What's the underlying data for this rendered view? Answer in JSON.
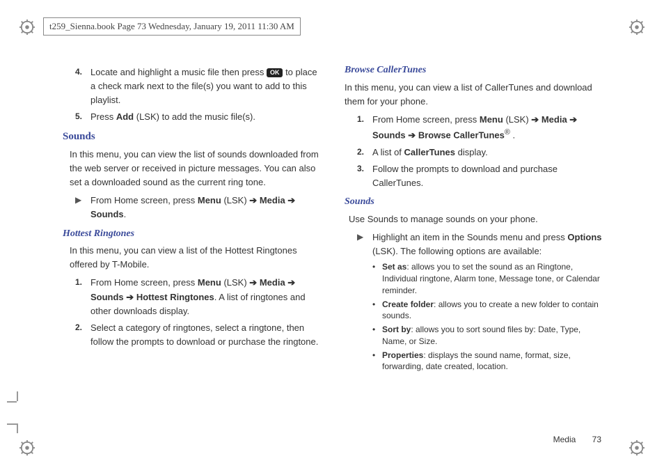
{
  "header": "t259_Sienna.book  Page 73  Wednesday, January 19, 2011  11:30 AM",
  "ok_label": "OK",
  "arrow": "➔",
  "tri": "▶",
  "left": {
    "step4_a": "Locate and highlight a music file then press ",
    "step4_b": " to place a check mark next to the file(s) you want to add to this playlist.",
    "step5_a": "Press ",
    "step5_b": "Add",
    "step5_c": " (LSK) to add the music file(s).",
    "sounds_h": "Sounds",
    "sounds_p": "In this menu, you can view the list of sounds downloaded from the web server or received in picture messages. You can also set a downloaded sound as the current ring tone.",
    "sounds_nav_a": "From Home screen, press ",
    "sounds_nav_b": "Menu",
    "sounds_nav_c": " (LSK) ",
    "sounds_nav_d": "Media",
    "sounds_nav_e": "Sounds",
    "hottest_h": "Hottest Ringtones",
    "hottest_p": "In this menu, you can view a list of the Hottest Ringtones offered by T-Mobile.",
    "hot1_a": "From Home screen, press ",
    "hot1_b": "Menu",
    "hot1_c": " (LSK) ",
    "hot1_d": "Media",
    "hot1_e": "Sounds",
    "hot1_f": "Hottest Ringtones",
    "hot1_g": ". A list of ringtones and other downloads display.",
    "hot2": "Select a category of ringtones, select a ringtone, then follow the prompts to download or purchase the ringtone."
  },
  "right": {
    "browse_h": "Browse CallerTunes",
    "browse_p": "In this menu, you can view a list of CallerTunes and download them for your phone.",
    "b1_a": "From Home screen, press ",
    "b1_b": "Menu",
    "b1_c": " (LSK) ",
    "b1_d": "Media",
    "b1_e": "Sounds",
    "b1_f": "Browse CallerTunes",
    "b1_g": " .",
    "b2_a": "A list of ",
    "b2_b": "CallerTunes",
    "b2_c": " display.",
    "b3": "Follow the prompts to download and purchase CallerTunes.",
    "sounds2_h": "Sounds",
    "sounds2_p": "Use Sounds to manage sounds on your phone.",
    "s_nav_a": "Highlight an item in the Sounds menu and press ",
    "s_nav_b": "Options",
    "s_nav_c": " (LSK). The following options are available:",
    "opt1_b": "Set as",
    "opt1_t": ": allows you to set the sound as an Ringtone, Individual ringtone, Alarm tone, Message tone, or Calendar reminder.",
    "opt2_b": "Create folder",
    "opt2_t": ": allows you to create a new folder to contain sounds.",
    "opt3_b": "Sort by",
    "opt3_t": ": allows you to sort sound files by: Date, Type, Name, or Size.",
    "opt4_b": "Properties",
    "opt4_t": ": displays the sound name, format, size, forwarding, date created, location."
  },
  "footer": {
    "label": "Media",
    "page": "73"
  },
  "nums": {
    "n1": "1.",
    "n2": "2.",
    "n3": "3.",
    "n4": "4.",
    "n5": "5."
  },
  "dot": "•",
  "period": ".",
  "reg": "®"
}
